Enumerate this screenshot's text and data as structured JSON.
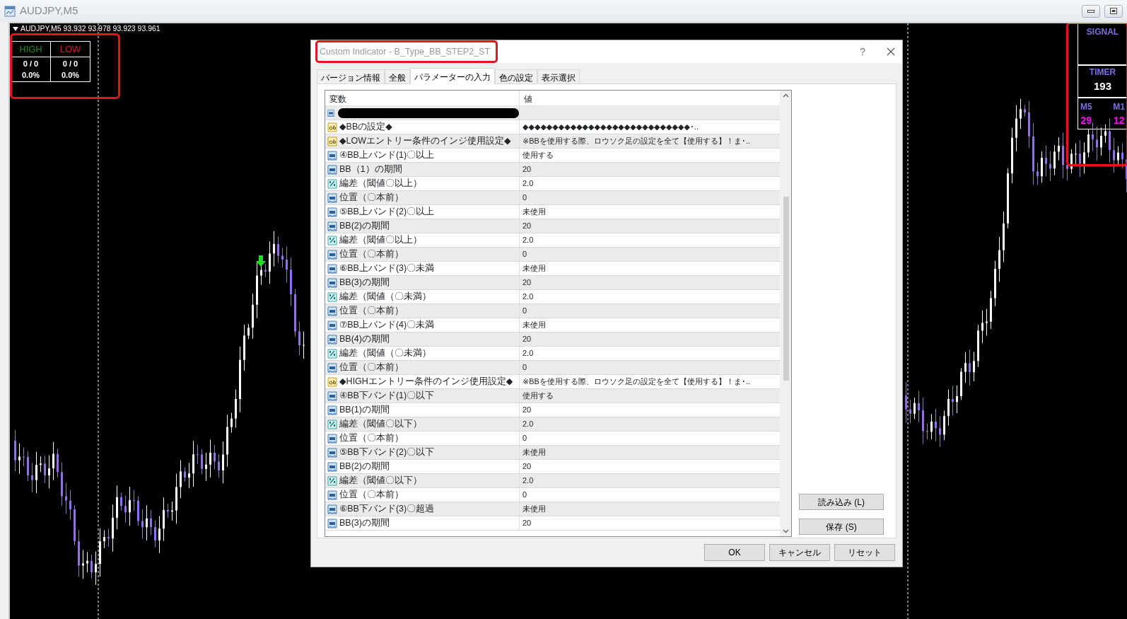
{
  "window": {
    "title": "AUDJPY,M5"
  },
  "chart": {
    "header": "AUDJPY,M5  93.932 93.978 93.923 93.961"
  },
  "stats_panel": {
    "columns": [
      {
        "label": "HIGH",
        "color": "#228b22",
        "count": "0 / 0",
        "rate": "0.0%"
      },
      {
        "label": "LOW",
        "color": "#dc143c",
        "count": "0 / 0",
        "rate": "0.0%"
      }
    ]
  },
  "signal_panel": {
    "signal": "SIGNAL",
    "timer_label": "TIMER",
    "timer": "193",
    "timeframes": [
      {
        "label": "M5",
        "value": "29"
      },
      {
        "label": "M1",
        "value": "12"
      }
    ]
  },
  "dialog": {
    "title": "Custom Indicator - B_Type_BB_STEP2_ST",
    "help": "?",
    "tabs": [
      {
        "label": "バージョン情報",
        "selected": false
      },
      {
        "label": "全般",
        "selected": false
      },
      {
        "label": "パラメーターの入力",
        "selected": true
      },
      {
        "label": "色の設定",
        "selected": false
      },
      {
        "label": "表示選択",
        "selected": false
      }
    ],
    "table": {
      "columns": [
        "変数",
        "値"
      ],
      "rows": [
        {
          "kind": "int",
          "redacted": true
        },
        {
          "kind": "string",
          "name": "◆BBの設定◆",
          "value": "◆◆◆◆◆◆◆◆◆◆◆◆◆◆◆◆◆◆◆◆◆◆◆◆◆◆◆◆･.."
        },
        {
          "kind": "string",
          "name": "◆LOWエントリー条件のインジ使用設定◆",
          "value": "※BBを使用する際、ロウソク足の設定を全て【使用する】！ま･.."
        },
        {
          "kind": "int",
          "name": "④BB上バンド(1)〇以上",
          "value": "使用する"
        },
        {
          "kind": "int",
          "name": "BB（1）の期間",
          "value": "20"
        },
        {
          "kind": "double",
          "name": "編差（閾値〇以上）",
          "value": "2.0"
        },
        {
          "kind": "int",
          "name": "位置（〇本前）",
          "value": "0"
        },
        {
          "kind": "int",
          "name": "⑤BB上バンド(2)〇以上",
          "value": "未使用"
        },
        {
          "kind": "int",
          "name": "BB(2)の期間",
          "value": "20"
        },
        {
          "kind": "double",
          "name": "編差（閾値〇以上）",
          "value": "2.0"
        },
        {
          "kind": "int",
          "name": "位置（〇本前）",
          "value": "0"
        },
        {
          "kind": "int",
          "name": "⑥BB上バンド(3)〇未満",
          "value": "未使用"
        },
        {
          "kind": "int",
          "name": "BB(3)の期間",
          "value": "20"
        },
        {
          "kind": "double",
          "name": "編差（閾値（〇未満）",
          "value": "2.0"
        },
        {
          "kind": "int",
          "name": "位置（〇本前）",
          "value": "0"
        },
        {
          "kind": "int",
          "name": "⑦BB上バンド(4)〇未満",
          "value": "未使用"
        },
        {
          "kind": "int",
          "name": "BB(4)の期間",
          "value": "20"
        },
        {
          "kind": "double",
          "name": "編差（閾値（〇未満）",
          "value": "2.0"
        },
        {
          "kind": "int",
          "name": "位置（〇本前）",
          "value": "0"
        },
        {
          "kind": "string",
          "name": "◆HIGHエントリー条件のインジ使用設定◆",
          "value": "※BBを使用する際、ロウソク足の設定を全て【使用する】！ま･.."
        },
        {
          "kind": "int",
          "name": "④BB下バンド(1)〇以下",
          "value": "使用する"
        },
        {
          "kind": "int",
          "name": "BB(1)の期間",
          "value": "20"
        },
        {
          "kind": "double",
          "name": "編差（閾値〇以下）",
          "value": "2.0"
        },
        {
          "kind": "int",
          "name": "位置（〇本前）",
          "value": "0"
        },
        {
          "kind": "int",
          "name": "⑤BB下バンド(2)〇以下",
          "value": "未使用"
        },
        {
          "kind": "int",
          "name": "BB(2)の期間",
          "value": "20"
        },
        {
          "kind": "double",
          "name": "編差（閾値〇以下）",
          "value": "2.0"
        },
        {
          "kind": "int",
          "name": "位置（〇本前）",
          "value": "0"
        },
        {
          "kind": "int",
          "name": "⑥BB下バンド(3)〇超過",
          "value": "未使用"
        },
        {
          "kind": "int",
          "name": "BB(3)の期間",
          "value": "20"
        }
      ]
    },
    "side_buttons": [
      "読み込み (L)",
      "保存 (S)"
    ],
    "buttons": [
      "OK",
      "キャンセル",
      "リセット"
    ]
  }
}
